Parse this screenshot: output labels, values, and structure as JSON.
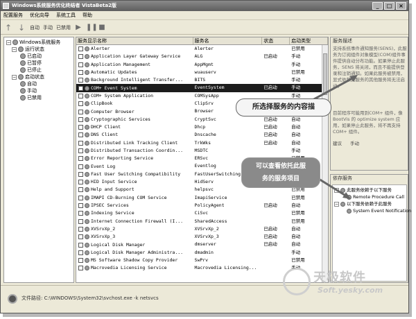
{
  "window": {
    "title": "Windows系统服务优化终结者 VistaBeta2版"
  },
  "menubar": [
    "配置服务",
    "优化向导",
    "系统工具",
    "帮助"
  ],
  "toolbar": {
    "auto": "自动",
    "manual": "手动",
    "disabled": "已禁用"
  },
  "tree": {
    "root": "Windows系统服务",
    "run_state": "运行状态",
    "started": "已启动",
    "paused": "已暂停",
    "stopped": "已停止",
    "startup_state": "启动状态",
    "auto": "自动",
    "manual": "手动",
    "disabled": "已禁用"
  },
  "table": {
    "headers": [
      "服务显示名称",
      "服务名",
      "状态",
      "启动类型"
    ],
    "rows": [
      {
        "display": "Alerter",
        "name": "Alerter",
        "status": "",
        "startup": "已禁用"
      },
      {
        "display": "Application Layer Gateway Service",
        "name": "ALG",
        "status": "已启动",
        "startup": "手动"
      },
      {
        "display": "Application Management",
        "name": "AppMgmt",
        "status": "",
        "startup": "手动"
      },
      {
        "display": "Automatic Updates",
        "name": "wuauserv",
        "status": "",
        "startup": "已禁用"
      },
      {
        "display": "Background Intelligent Transfer...",
        "name": "BITS",
        "status": "",
        "startup": "手动"
      },
      {
        "display": "COM+ Event System",
        "name": "EventSystem",
        "status": "已启动",
        "startup": "手动",
        "selected": true
      },
      {
        "display": "COM+ System Application",
        "name": "COMSysApp",
        "status": "",
        "startup": "手动"
      },
      {
        "display": "ClipBook",
        "name": "ClipSrv",
        "status": "",
        "startup": "已禁用"
      },
      {
        "display": "Computer Browser",
        "name": "Browser",
        "status": "已启动",
        "startup": "自动"
      },
      {
        "display": "Cryptographic Services",
        "name": "CryptSvc",
        "status": "已启动",
        "startup": "自动"
      },
      {
        "display": "DHCP Client",
        "name": "Dhcp",
        "status": "已启动",
        "startup": "自动"
      },
      {
        "display": "DNS Client",
        "name": "Dnscache",
        "status": "已启动",
        "startup": "自动"
      },
      {
        "display": "Distributed Link Tracking Client",
        "name": "TrkWks",
        "status": "已启动",
        "startup": "自动"
      },
      {
        "display": "Distributed Transaction Coordin...",
        "name": "MSDTC",
        "status": "",
        "startup": "手动"
      },
      {
        "display": "Error Reporting Service",
        "name": "ERSvc",
        "status": "",
        "startup": "已禁用"
      },
      {
        "display": "Event Log",
        "name": "Eventlog",
        "status": "已启动",
        "startup": "自动"
      },
      {
        "display": "Fast User Switching Compatibility",
        "name": "FastUserSwitching...",
        "status": "",
        "startup": "手动"
      },
      {
        "display": "HID Input Service",
        "name": "HidServ",
        "status": "",
        "startup": "已禁用"
      },
      {
        "display": "Help and Support",
        "name": "helpsvc",
        "status": "",
        "startup": "已禁用"
      },
      {
        "display": "IMAPI CD-Burning COM Service",
        "name": "ImapiService",
        "status": "",
        "startup": "已禁用"
      },
      {
        "display": "IPSEC Services",
        "name": "PolicyAgent",
        "status": "已启动",
        "startup": "自动"
      },
      {
        "display": "Indexing Service",
        "name": "CiSvc",
        "status": "",
        "startup": "已禁用"
      },
      {
        "display": "Internet Connection Firewall (I...",
        "name": "SharedAccess",
        "status": "",
        "startup": "已禁用"
      },
      {
        "display": "XVSrvXp_2",
        "name": "XVSrvXp_2",
        "status": "已启动",
        "startup": "自动"
      },
      {
        "display": "XVSrvXp_3",
        "name": "XVSrvXp_3",
        "status": "已启动",
        "startup": "自动"
      },
      {
        "display": "Logical Disk Manager",
        "name": "dmserver",
        "status": "已启动",
        "startup": "自动"
      },
      {
        "display": "Logical Disk Manager Administra...",
        "name": "dmadmin",
        "status": "",
        "startup": "手动"
      },
      {
        "display": "MS Software Shadow Copy Provider",
        "name": "SwPrv",
        "status": "",
        "startup": "已禁用"
      },
      {
        "display": "Macrovedia Licensing Service",
        "name": "Macrovedia Licensing...",
        "status": "",
        "startup": "手动"
      }
    ]
  },
  "description": {
    "title": "服务描述",
    "text1": "支持系统事件通知服务(SENS)，此服务为订阅组件对象模型(COM)组件事件提供自动分布功能。如果停止此服务，SENS 将关闭，而且不能提供登录和注销通知。如果此服务被禁用，显式依赖此服务的其他服务将无法启动。",
    "text2": "目前程序可能用到COM+ 组件，像BootVis 的 optimize system 应用，如果停止此服务，将不再支持 COM+ 组件。",
    "foot_left": "建议",
    "foot_right": "手动"
  },
  "dependencies": {
    "title": "依存服务",
    "node1": "此服务依赖于以下服务",
    "node1_child": "Remote Procedure Call",
    "node2": "以下服务依赖于此服务",
    "node2_child": "System Event Notification"
  },
  "status": {
    "path": "文件路径: C:\\WINDOWS\\System32\\svchost.exe -k netsvcs"
  },
  "callouts": {
    "select_hint": "所选择服务的内容描",
    "dep_line1": "可以查看依托此服",
    "dep_line2": "务的服务项目"
  },
  "watermark": {
    "brand": "天极软件",
    "site": "Soft.yesky.com"
  }
}
